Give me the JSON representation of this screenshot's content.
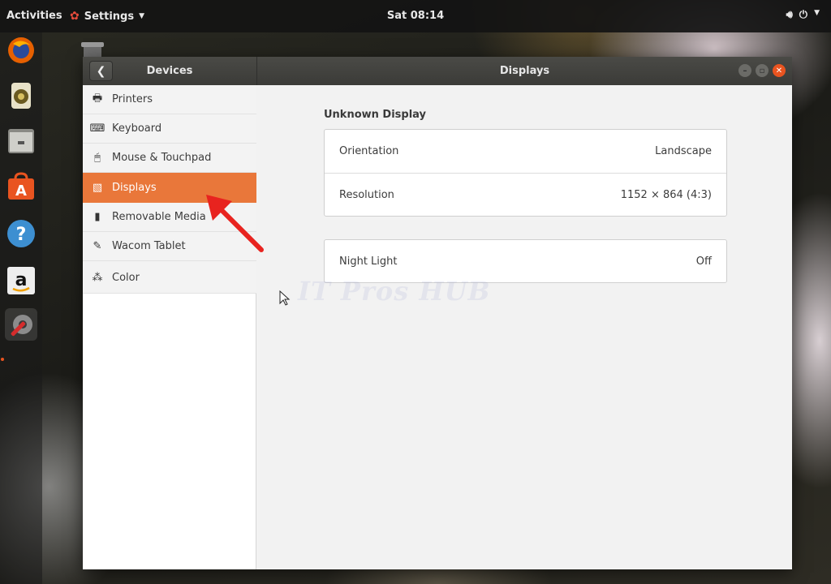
{
  "topbar": {
    "activities": "Activities",
    "app_name": "Settings",
    "clock": "Sat 08:14"
  },
  "dock": {
    "items": [
      "firefox-icon",
      "rhythmbox-icon",
      "files-icon",
      "software-center-icon",
      "help-icon",
      "amazon-icon",
      "settings-icon"
    ]
  },
  "window": {
    "sidebar_title": "Devices",
    "panel_title": "Displays",
    "sidebar": {
      "items": [
        {
          "label": "Printers",
          "icon": "printer-icon"
        },
        {
          "label": "Keyboard",
          "icon": "keyboard-icon"
        },
        {
          "label": "Mouse & Touchpad",
          "icon": "mouse-icon"
        },
        {
          "label": "Displays",
          "icon": "display-icon",
          "selected": true
        },
        {
          "label": "Removable Media",
          "icon": "usb-drive-icon"
        },
        {
          "label": "Wacom Tablet",
          "icon": "tablet-icon"
        },
        {
          "label": "Color",
          "icon": "color-icon"
        }
      ]
    },
    "display": {
      "name": "Unknown Display",
      "orientation_label": "Orientation",
      "orientation_value": "Landscape",
      "resolution_label": "Resolution",
      "resolution_value": "1152 × 864 (4:3)",
      "night_light_label": "Night Light",
      "night_light_value": "Off"
    }
  },
  "watermark": "IT Pros HUB",
  "colors": {
    "accent": "#e95420",
    "selected_row": "#e9773a"
  }
}
